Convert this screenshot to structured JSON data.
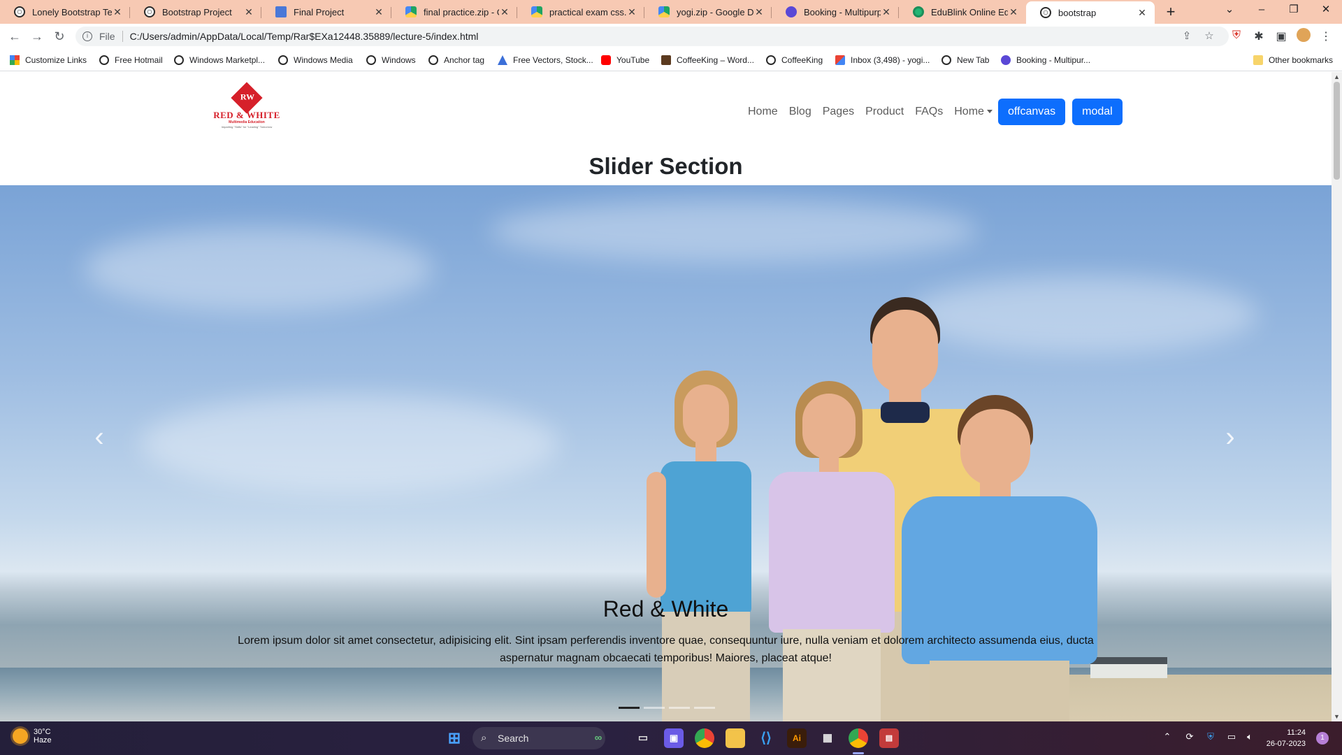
{
  "browser": {
    "tabs": [
      {
        "title": "Lonely Bootstrap Temp",
        "icon": "globe-icon"
      },
      {
        "title": "Bootstrap Project",
        "icon": "globe-icon"
      },
      {
        "title": "Final Project",
        "icon": "document-icon"
      },
      {
        "title": "final practice.zip - Goo",
        "icon": "google-drive-icon"
      },
      {
        "title": "practical exam css.zip",
        "icon": "google-drive-icon"
      },
      {
        "title": "yogi.zip - Google Drive",
        "icon": "google-drive-icon"
      },
      {
        "title": "Booking - Multipurpo",
        "icon": "booking-icon"
      },
      {
        "title": "EduBlink Online Educa",
        "icon": "edublink-icon"
      },
      {
        "title": "bootstrap",
        "icon": "globe-icon"
      }
    ],
    "address": {
      "scheme": "File",
      "url": "C:/Users/admin/AppData/Local/Temp/Rar$EXa12448.35889/lecture-5/index.html"
    },
    "bookmarks": [
      {
        "label": "Customize Links",
        "icon": "apps-grid-icon"
      },
      {
        "label": "Free Hotmail",
        "icon": "globe-icon"
      },
      {
        "label": "Windows Marketpl...",
        "icon": "globe-icon"
      },
      {
        "label": "Windows Media",
        "icon": "globe-icon"
      },
      {
        "label": "Windows",
        "icon": "globe-icon"
      },
      {
        "label": "Anchor tag",
        "icon": "globe-icon"
      },
      {
        "label": "Free Vectors, Stock...",
        "icon": "vector-icon"
      },
      {
        "label": "YouTube",
        "icon": "youtube-icon"
      },
      {
        "label": "CoffeeKing – Word...",
        "icon": "coffee-icon"
      },
      {
        "label": "CoffeeKing",
        "icon": "globe-icon"
      },
      {
        "label": "Inbox (3,498) - yogi...",
        "icon": "gmail-icon"
      },
      {
        "label": "New Tab",
        "icon": "globe-icon"
      },
      {
        "label": "Booking - Multipur...",
        "icon": "booking-icon"
      }
    ],
    "other_bookmarks": "Other bookmarks"
  },
  "page": {
    "logo": {
      "mark": "RW",
      "name": "RED & WHITE",
      "sub": "Multimedia Education",
      "tagline": "Imparting \"Skills\" for \"Leading\" Tomorrow"
    },
    "nav": {
      "links": [
        "Home",
        "Blog",
        "Pages",
        "Product",
        "FAQs"
      ],
      "dropdown": "Home",
      "buttons": [
        "offcanvas",
        "modal"
      ]
    },
    "section_title": "Slider Section",
    "carousel": {
      "caption_title": "Red & White",
      "caption_text": "Lorem ipsum dolor sit amet consectetur, adipisicing elit. Sint ipsam perferendis inventore quae, consequuntur iure, nulla veniam et dolorem architecto assumenda eius, ducta aspernatur magnam obcaecati temporibus! Maiores, placeat atque!",
      "prev": "‹",
      "next": "›",
      "slides": 4,
      "active_slide": 1
    }
  },
  "taskbar": {
    "weather": {
      "temp": "30°C",
      "condition": "Haze"
    },
    "search": "Search",
    "time": "11:24",
    "date": "26-07-2023",
    "notifications": "1"
  },
  "colors": {
    "tabstrip": "#f7c9b3",
    "primary": "#0d6efd",
    "brand_red": "#d6202a"
  }
}
